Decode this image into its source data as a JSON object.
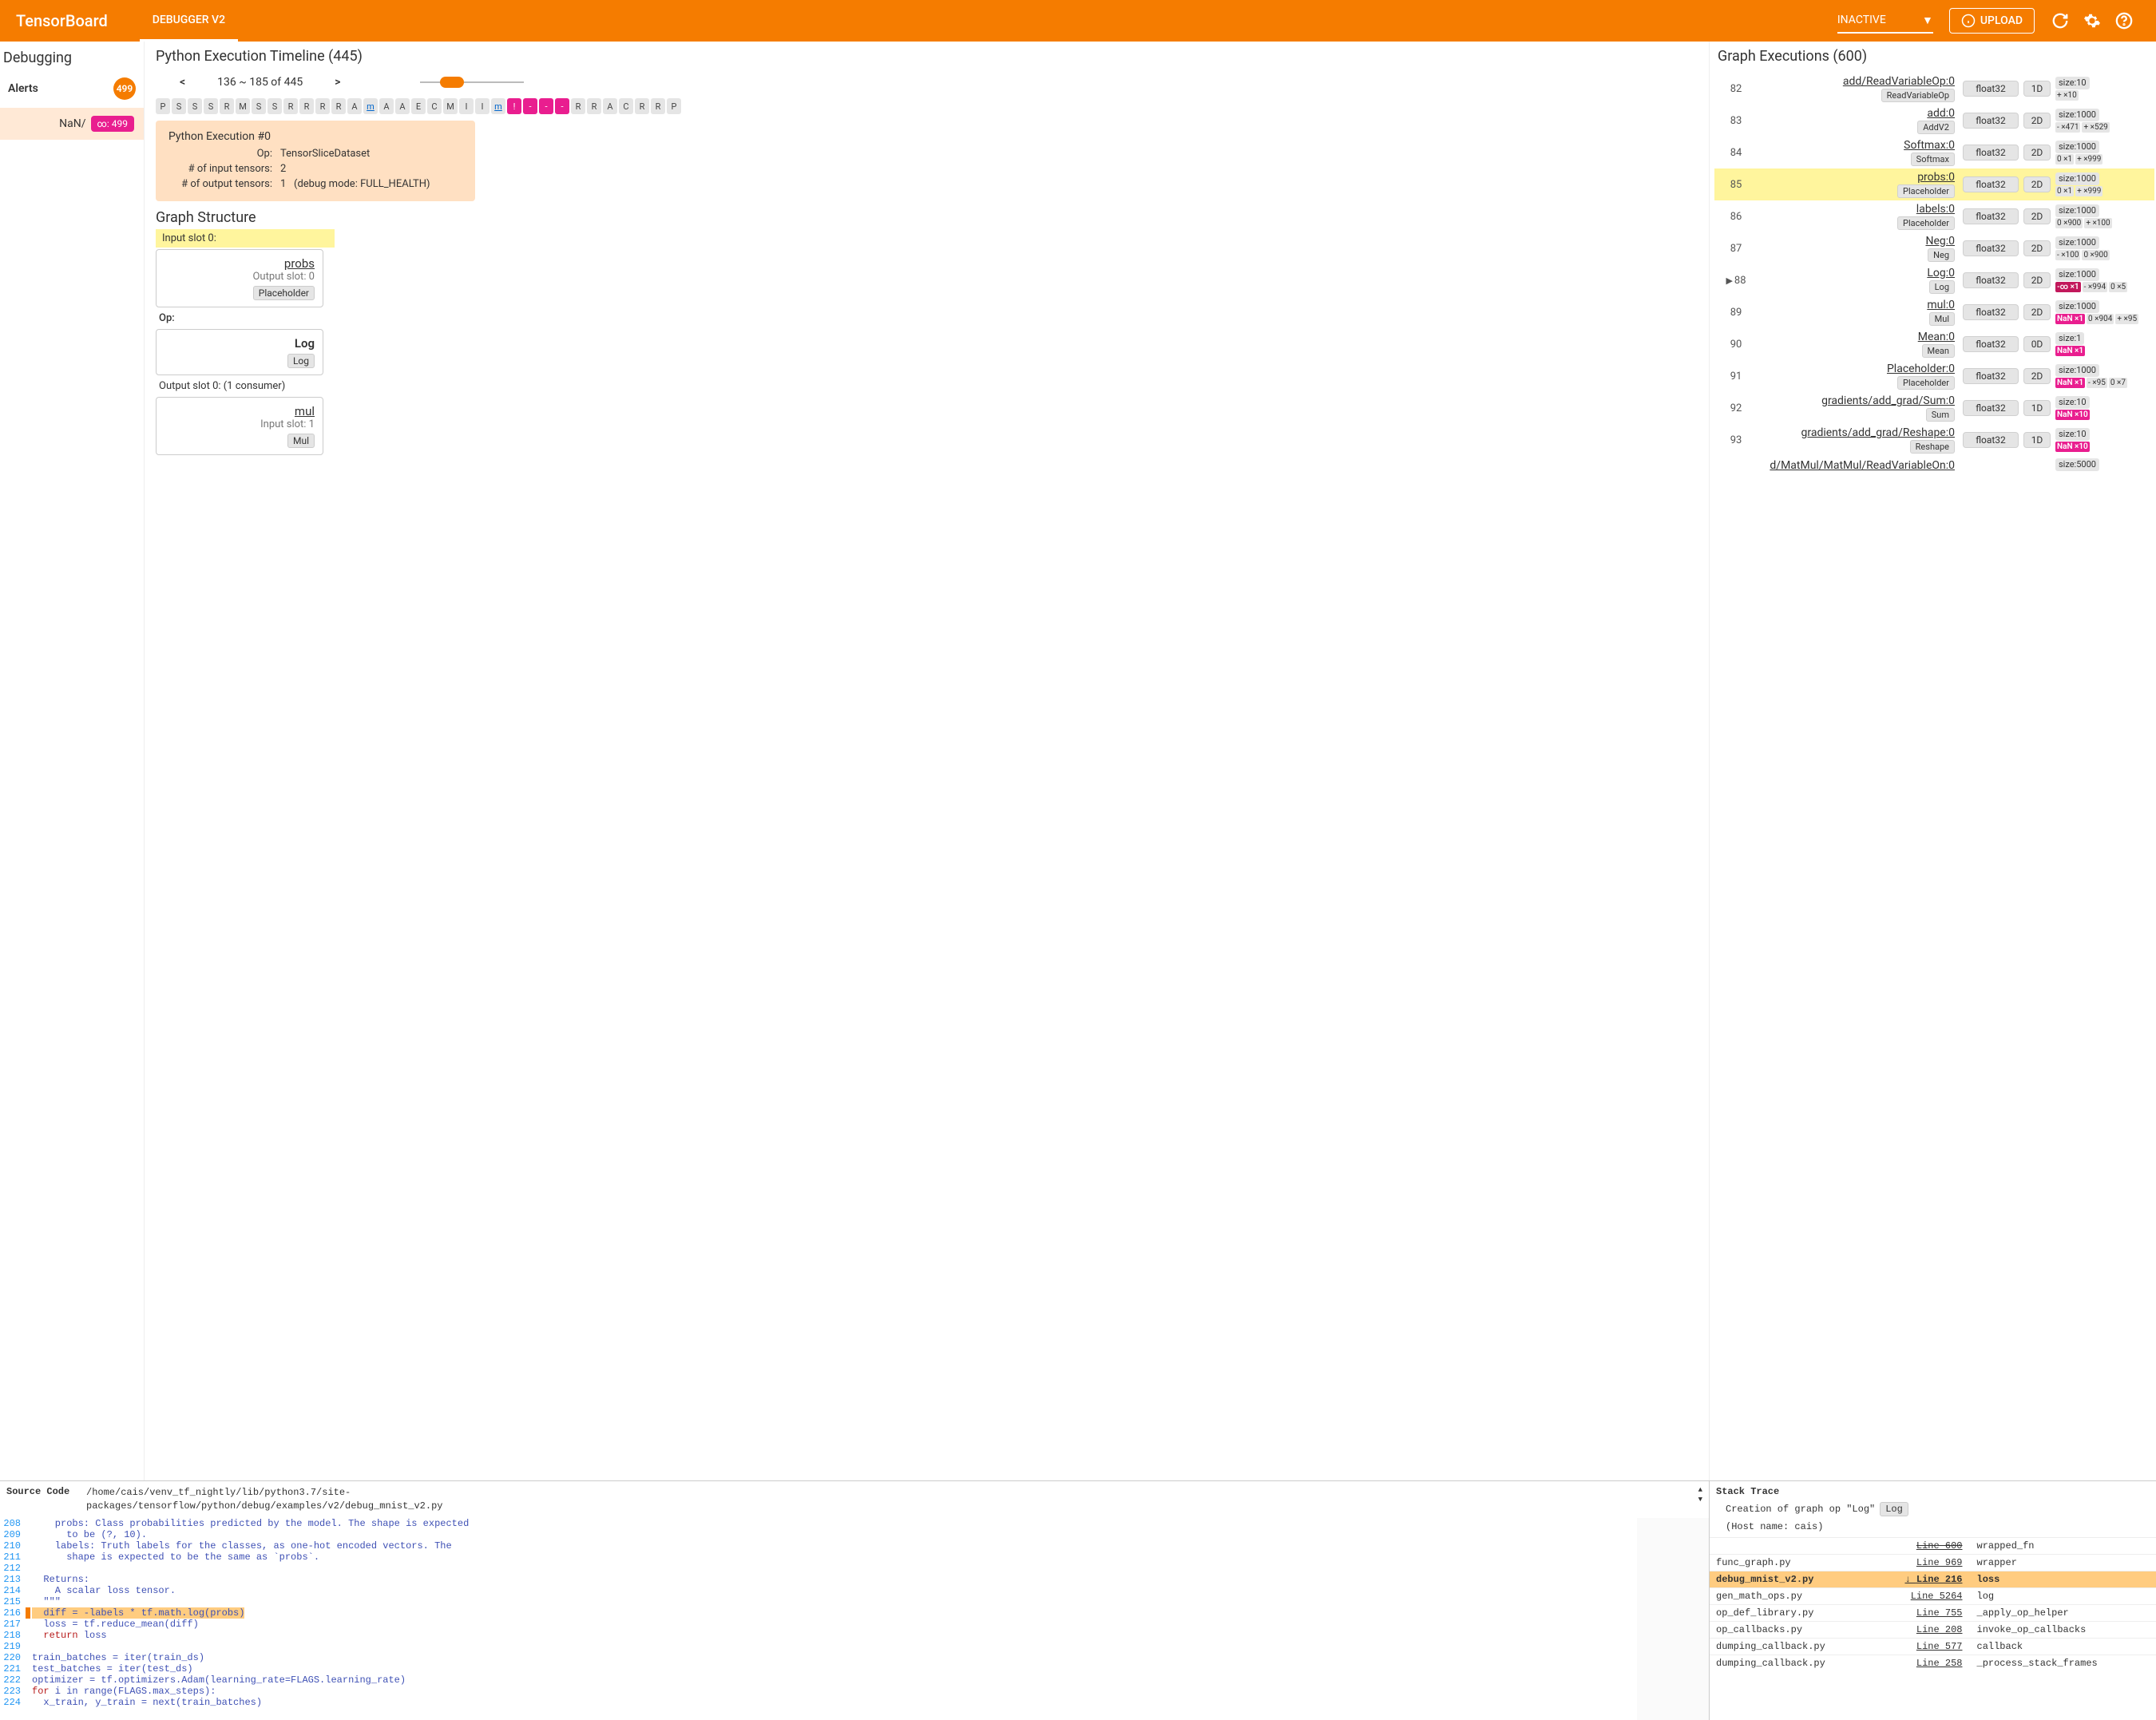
{
  "header": {
    "logo": "TensorBoard",
    "tab": "DEBUGGER V2",
    "status": "INACTIVE",
    "upload": "UPLOAD"
  },
  "debugging": {
    "title": "Debugging",
    "alerts_label": "Alerts",
    "alerts_count": "499",
    "nan_label": "NaN/",
    "nan_count": "∞: 499"
  },
  "timeline": {
    "title": "Python Execution Timeline (445)",
    "nav": "136 ~ 185 of 445",
    "chips": [
      "P",
      "S",
      "S",
      "S",
      "R",
      "M",
      "S",
      "S",
      "R",
      "R",
      "R",
      "R",
      "A",
      "m",
      "A",
      "A",
      "E",
      "C",
      "M",
      "I",
      "I",
      "m",
      "!",
      "-",
      "-",
      "-",
      "R",
      "R",
      "A",
      "C",
      "R",
      "R",
      "P"
    ],
    "activeStart": 22,
    "activeEnd": 25,
    "linkIdx": [
      13,
      21
    ],
    "detail": {
      "title": "Python Execution #0",
      "op_lbl": "Op:",
      "op": "TensorSliceDataset",
      "in_lbl": "# of input tensors:",
      "in": "2",
      "out_lbl": "# of output tensors:",
      "out": "1",
      "out_extra": "(debug mode: FULL_HEALTH)"
    }
  },
  "graph_struct": {
    "title": "Graph Structure",
    "input_slot_hdr": "Input slot 0:",
    "input": {
      "name": "probs",
      "slot": "Output slot: 0",
      "tag": "Placeholder"
    },
    "op_hdr": "Op:",
    "op": {
      "name": "Log",
      "tag": "Log"
    },
    "output_slot_hdr": "Output slot 0: (1 consumer)",
    "output": {
      "name": "mul",
      "slot": "Input slot: 1",
      "tag": "Mul"
    }
  },
  "graph_exec": {
    "title": "Graph Executions (600)",
    "rows": [
      {
        "idx": "82",
        "name": "add/ReadVariableOp:0",
        "type": "ReadVariableOp",
        "dtype": "float32",
        "dim": "1D",
        "size": "size:10",
        "badges": [
          {
            "t": "g",
            "v": "+ ×10"
          }
        ]
      },
      {
        "idx": "83",
        "name": "add:0",
        "type": "AddV2",
        "dtype": "float32",
        "dim": "2D",
        "size": "size:1000",
        "badges": [
          {
            "t": "g",
            "v": "- ×471"
          },
          {
            "t": "g",
            "v": "+ ×529"
          }
        ]
      },
      {
        "idx": "84",
        "name": "Softmax:0",
        "type": "Softmax",
        "dtype": "float32",
        "dim": "2D",
        "size": "size:1000",
        "badges": [
          {
            "t": "g",
            "v": "0 ×1"
          },
          {
            "t": "g",
            "v": "+ ×999"
          }
        ]
      },
      {
        "idx": "85",
        "name": "probs:0",
        "type": "Placeholder",
        "dtype": "float32",
        "dim": "2D",
        "size": "size:1000",
        "badges": [
          {
            "t": "g",
            "v": "0 ×1"
          },
          {
            "t": "g",
            "v": "+ ×999"
          }
        ],
        "sel": true
      },
      {
        "idx": "86",
        "name": "labels:0",
        "type": "Placeholder",
        "dtype": "float32",
        "dim": "2D",
        "size": "size:1000",
        "badges": [
          {
            "t": "g",
            "v": "0 ×900"
          },
          {
            "t": "g",
            "v": "+ ×100"
          }
        ]
      },
      {
        "idx": "87",
        "name": "Neg:0",
        "type": "Neg",
        "dtype": "float32",
        "dim": "2D",
        "size": "size:1000",
        "badges": [
          {
            "t": "g",
            "v": "- ×100"
          },
          {
            "t": "g",
            "v": "0 ×900"
          }
        ]
      },
      {
        "idx": "88",
        "name": "Log:0",
        "type": "Log",
        "dtype": "float32",
        "dim": "2D",
        "size": "size:1000",
        "badges": [
          {
            "t": "inf",
            "v": "-∞ ×1"
          },
          {
            "t": "g",
            "v": "- ×994"
          },
          {
            "t": "g",
            "v": "0 ×5"
          }
        ],
        "marker": true
      },
      {
        "idx": "89",
        "name": "mul:0",
        "type": "Mul",
        "dtype": "float32",
        "dim": "2D",
        "size": "size:1000",
        "badges": [
          {
            "t": "nan",
            "v": "NaN ×1"
          },
          {
            "t": "g",
            "v": "0 ×904"
          },
          {
            "t": "g",
            "v": "+ ×95"
          }
        ]
      },
      {
        "idx": "90",
        "name": "Mean:0",
        "type": "Mean",
        "dtype": "float32",
        "dim": "0D",
        "size": "size:1",
        "badges": [
          {
            "t": "nan",
            "v": "NaN ×1"
          }
        ]
      },
      {
        "idx": "91",
        "name": "Placeholder:0",
        "type": "Placeholder",
        "dtype": "float32",
        "dim": "2D",
        "size": "size:1000",
        "badges": [
          {
            "t": "nan",
            "v": "NaN ×1"
          },
          {
            "t": "g",
            "v": "- ×95"
          },
          {
            "t": "g",
            "v": "0 ×7"
          }
        ]
      },
      {
        "idx": "92",
        "name": "gradients/add_grad/Sum:0",
        "type": "Sum",
        "dtype": "float32",
        "dim": "1D",
        "size": "size:10",
        "badges": [
          {
            "t": "nan",
            "v": "NaN ×10"
          }
        ]
      },
      {
        "idx": "93",
        "name": "gradients/add_grad/Reshape:0",
        "type": "Reshape",
        "dtype": "float32",
        "dim": "1D",
        "size": "size:10",
        "badges": [
          {
            "t": "nan",
            "v": "NaN ×10"
          }
        ]
      },
      {
        "idx": "",
        "name": "d/MatMul/MatMul/ReadVariableOn:0",
        "type": "",
        "dtype": "",
        "dim": "",
        "size": "size:5000",
        "badges": []
      }
    ]
  },
  "source": {
    "label": "Source Code",
    "path1": "/home/cais/venv_tf_nightly/lib/python3.7/site-",
    "path2": "packages/tensorflow/python/debug/examples/v2/debug_mnist_v2.py",
    "lines": [
      {
        "n": "208",
        "c": "    probs: Class probabilities predicted by the model. The shape is expected"
      },
      {
        "n": "209",
        "c": "      to be (?, 10)."
      },
      {
        "n": "210",
        "c": "    labels: Truth labels for the classes, as one-hot encoded vectors. The"
      },
      {
        "n": "211",
        "c": "      shape is expected to be the same as `probs`."
      },
      {
        "n": "212",
        "c": ""
      },
      {
        "n": "213",
        "c": "  Returns:"
      },
      {
        "n": "214",
        "c": "    A scalar loss tensor."
      },
      {
        "n": "215",
        "c": "  \"\"\""
      },
      {
        "n": "216",
        "c": "  diff = -labels * tf.math.log(probs)",
        "hl": true
      },
      {
        "n": "217",
        "c": "  loss = tf.reduce_mean(diff)"
      },
      {
        "n": "218",
        "c": "  return loss",
        "kw": "return"
      },
      {
        "n": "219",
        "c": ""
      },
      {
        "n": "220",
        "c": "train_batches = iter(train_ds)"
      },
      {
        "n": "221",
        "c": "test_batches = iter(test_ds)"
      },
      {
        "n": "222",
        "c": "optimizer = tf.optimizers.Adam(learning_rate=FLAGS.learning_rate)"
      },
      {
        "n": "223",
        "c": "for i in range(FLAGS.max_steps):",
        "kw": "for"
      },
      {
        "n": "224",
        "c": "  x_train, y_train = next(train_batches)"
      }
    ]
  },
  "stack": {
    "title": "Stack Trace",
    "sub_pre": "Creation of graph op \"Log\"",
    "sub_tag": "Log",
    "host": "(Host name: cais)",
    "rows": [
      {
        "file": "",
        "line": "Line 600",
        "fn": "wrapped_fn",
        "strike": true
      },
      {
        "file": "func_graph.py",
        "line": "Line 969",
        "fn": "wrapper"
      },
      {
        "file": "debug_mnist_v2.py",
        "line": "Line 216",
        "fn": "loss",
        "hl": true,
        "arrow": true
      },
      {
        "file": "gen_math_ops.py",
        "line": "Line 5264",
        "fn": "log"
      },
      {
        "file": "op_def_library.py",
        "line": "Line 755",
        "fn": "_apply_op_helper"
      },
      {
        "file": "op_callbacks.py",
        "line": "Line 208",
        "fn": "invoke_op_callbacks"
      },
      {
        "file": "dumping_callback.py",
        "line": "Line 577",
        "fn": "callback"
      },
      {
        "file": "dumping_callback.py",
        "line": "Line 258",
        "fn": "_process_stack_frames"
      }
    ]
  }
}
